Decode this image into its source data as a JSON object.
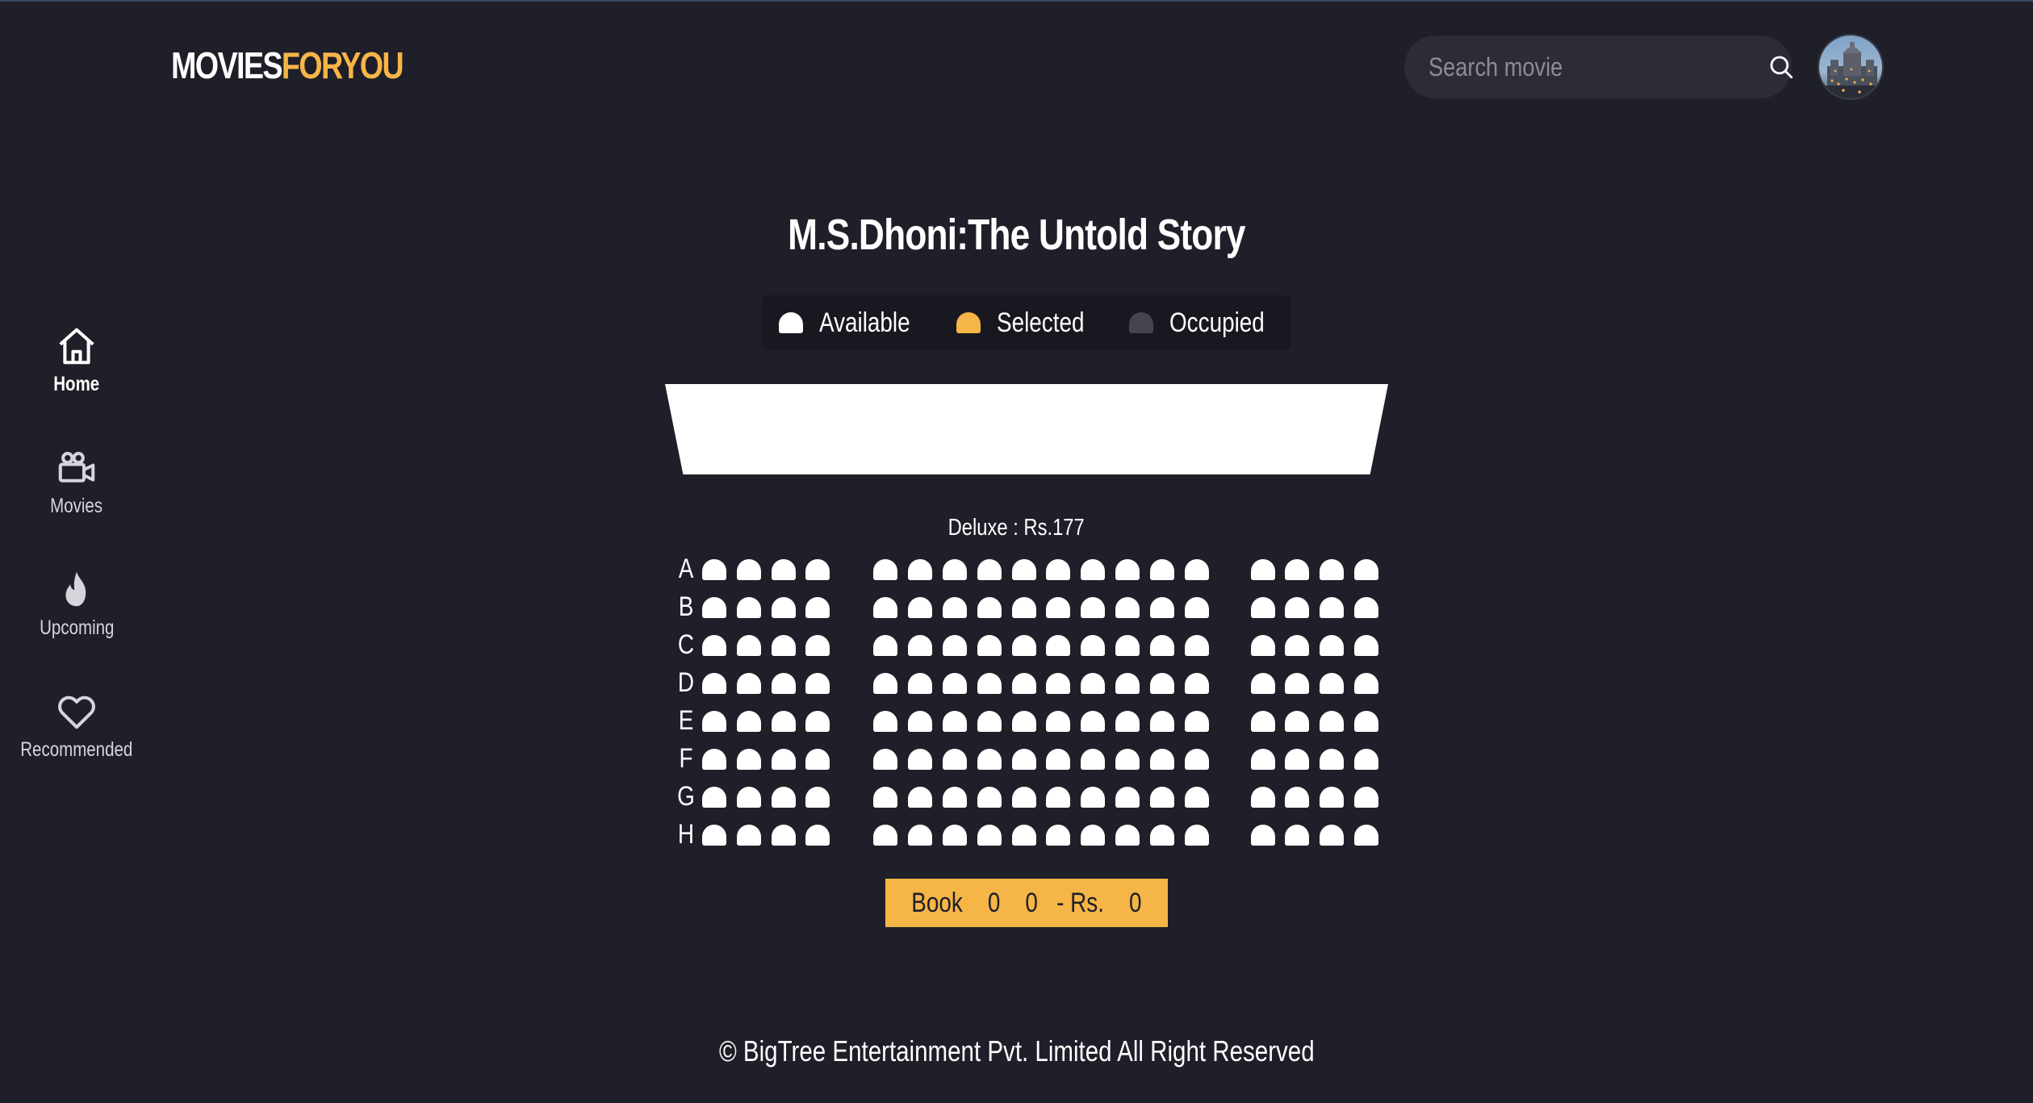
{
  "header": {
    "logo_part1": "MOVIES",
    "logo_part2": "FORYOU",
    "search_placeholder": "Search movie"
  },
  "sidebar": {
    "items": [
      {
        "label": "Home",
        "icon": "home-icon",
        "active": true
      },
      {
        "label": "Movies",
        "icon": "video-camera-icon"
      },
      {
        "label": "Upcoming",
        "icon": "fire-icon"
      },
      {
        "label": "Recommended",
        "icon": "heart-icon"
      }
    ]
  },
  "movie": {
    "title": "M.S.Dhoni:The Untold Story"
  },
  "legend": {
    "available": "Available",
    "selected": "Selected",
    "occupied": "Occupied"
  },
  "colors": {
    "background": "#1f1f29",
    "accent": "#f5b547",
    "available_seat": "#ffffff",
    "selected_seat": "#f5b547",
    "occupied_seat": "#44454f"
  },
  "seating": {
    "tier": "Deluxe : Rs.177",
    "rows": [
      "A",
      "B",
      "C",
      "D",
      "E",
      "F",
      "G",
      "H"
    ],
    "left_block_seats": 4,
    "middle_block_seats": 10,
    "right_block_seats": 4
  },
  "booking": {
    "label": "Book",
    "count": "0",
    "seats": "0",
    "currency": "- Rs.",
    "total": "0"
  },
  "footer": {
    "copyright": "© BigTree Entertainment Pvt. Limited All Right Reserved"
  }
}
